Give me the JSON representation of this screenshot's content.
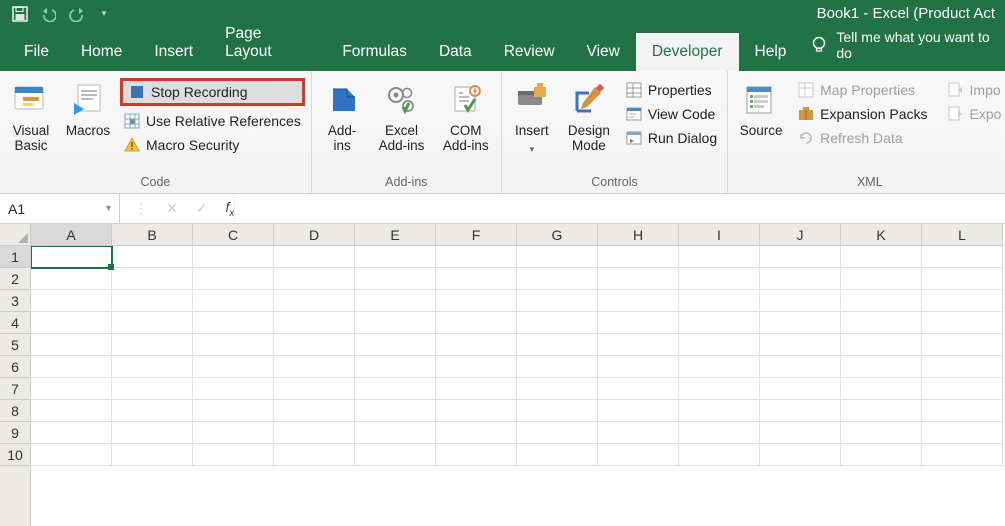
{
  "titlebar": {
    "title": "Book1  -  Excel (Product Act"
  },
  "tabs": [
    "File",
    "Home",
    "Insert",
    "Page Layout",
    "Formulas",
    "Data",
    "Review",
    "View",
    "Developer",
    "Help"
  ],
  "active_tab": "Developer",
  "tellme": "Tell me what you want to do",
  "ribbon": {
    "code": {
      "visual_basic": "Visual\nBasic",
      "macros": "Macros",
      "stop_recording": "Stop Recording",
      "use_relative": "Use Relative References",
      "macro_security": "Macro Security",
      "label": "Code"
    },
    "addins": {
      "addins": "Add-\nins",
      "excel_addins": "Excel\nAdd-ins",
      "com_addins": "COM\nAdd-ins",
      "label": "Add-ins"
    },
    "controls": {
      "insert": "Insert",
      "design_mode": "Design\nMode",
      "properties": "Properties",
      "view_code": "View Code",
      "run_dialog": "Run Dialog",
      "label": "Controls"
    },
    "xml": {
      "source": "Source",
      "map_properties": "Map Properties",
      "expansion_packs": "Expansion Packs",
      "refresh_data": "Refresh Data",
      "import": "Impo",
      "export": "Expo",
      "label": "XML"
    }
  },
  "namebox": "A1",
  "columns": [
    "A",
    "B",
    "C",
    "D",
    "E",
    "F",
    "G",
    "H",
    "I",
    "J",
    "K",
    "L"
  ],
  "rows": [
    "1",
    "2",
    "3",
    "4",
    "5",
    "6",
    "7",
    "8",
    "9",
    "10"
  ],
  "selected_cell": "A1"
}
